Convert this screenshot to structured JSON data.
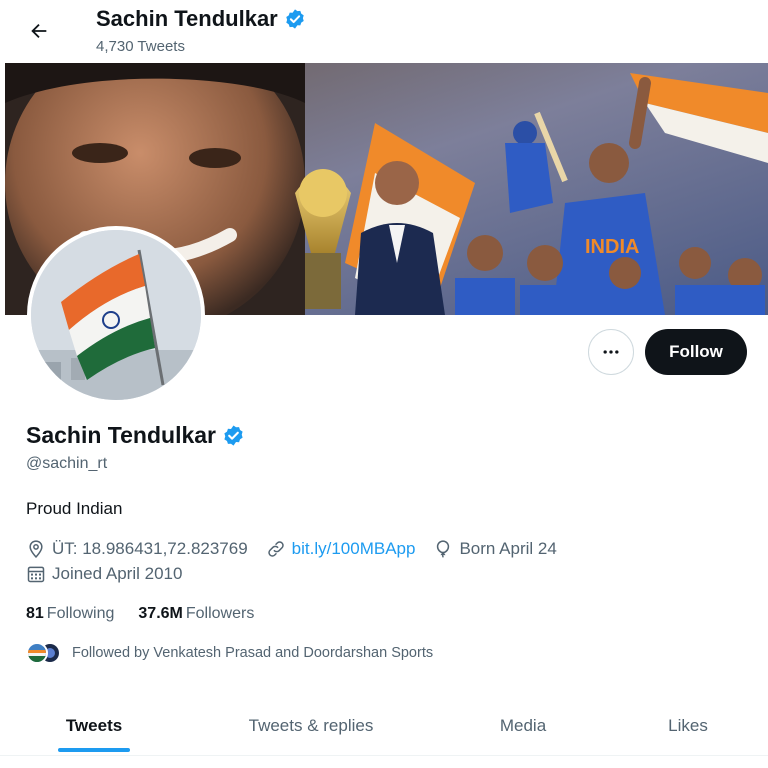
{
  "header": {
    "title": "Sachin Tendulkar",
    "tweet_count": "4,730 Tweets"
  },
  "profile": {
    "name": "Sachin Tendulkar",
    "handle": "@sachin_rt",
    "bio": "Proud Indian",
    "location": "ÜT: 18.986431,72.823769",
    "website": "bit.ly/100MBApp",
    "birthday": "Born April 24",
    "joined": "Joined April 2010",
    "verified": true
  },
  "actions": {
    "follow_label": "Follow"
  },
  "stats": {
    "following_count": "81",
    "following_label": "Following",
    "followers_count": "37.6M",
    "followers_label": "Followers"
  },
  "followed_by": {
    "text": "Followed by Venkatesh Prasad and Doordarshan Sports"
  },
  "tabs": [
    {
      "label": "Tweets",
      "active": true
    },
    {
      "label": "Tweets & replies",
      "active": false
    },
    {
      "label": "Media",
      "active": false
    },
    {
      "label": "Likes",
      "active": false
    }
  ],
  "colors": {
    "accent": "#1d9bf0",
    "text_primary": "#0f1419",
    "text_secondary": "#536471",
    "follow_button_bg": "#0f1419"
  },
  "icons": {
    "back": "arrow-left-icon",
    "verified": "verified-badge-icon",
    "more": "more-options-icon",
    "location": "location-pin-icon",
    "link": "link-icon",
    "birthday": "balloon-icon",
    "joined": "calendar-icon"
  }
}
